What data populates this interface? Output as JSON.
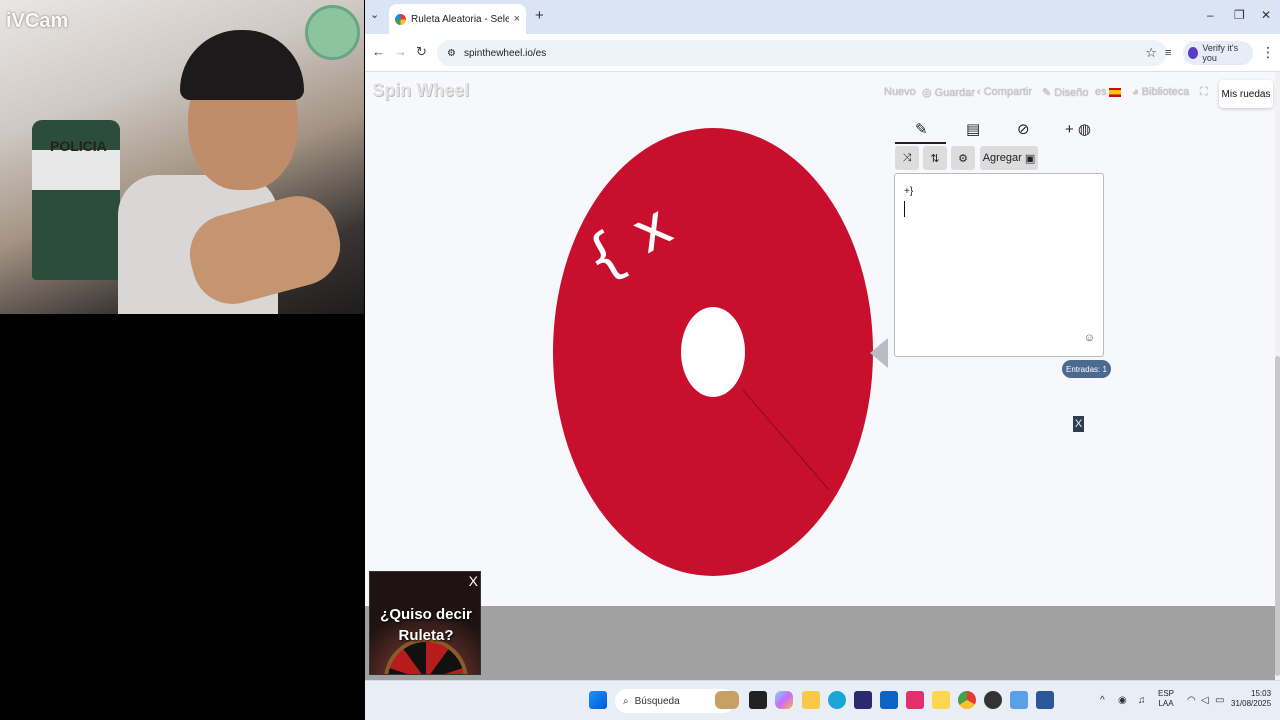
{
  "camera": {
    "label": "iVCam",
    "sign_text": "POLICIA"
  },
  "browser": {
    "tab_title": "Ruleta Aleatoria - Selector Pers",
    "tab_close": "×",
    "new_tab": "+",
    "window_controls": [
      "–",
      "❐",
      "✕"
    ],
    "url": "spinthewheel.io/es",
    "profile_label": "Verify it's you"
  },
  "site": {
    "logo": "Spin Wheel",
    "nav": [
      "Nuevo",
      "Guardar",
      "Compartir",
      "Diseño",
      "es",
      "Biblioteca"
    ],
    "my_wheels": "Mis ruedas",
    "wheel": {
      "color": "#c8102e",
      "inner_text": "{ x"
    },
    "panel": {
      "add_label": "Agregar",
      "entries_text": "+}",
      "count_label": "Entradas: 1",
      "x_label": "X"
    }
  },
  "ad": {
    "text_line1": "¿Quiso decir",
    "text_line2": "Ruleta?",
    "close": "X"
  },
  "taskbar": {
    "search_label": "Búsqueda",
    "lang_top": "ESP",
    "lang_bottom": "LAA",
    "time": "15:03",
    "date": "31/08/2025"
  }
}
